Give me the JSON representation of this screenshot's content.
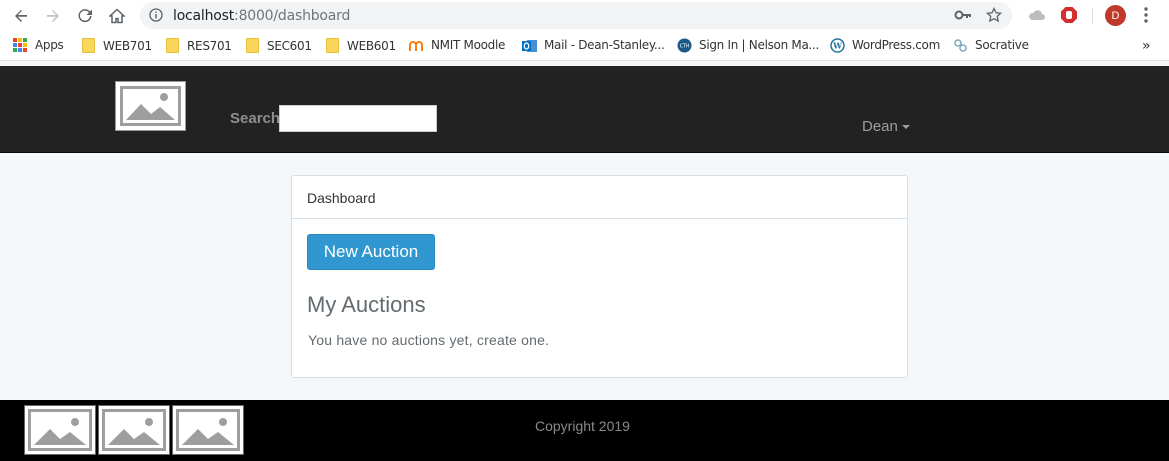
{
  "browser": {
    "url_host": "localhost",
    "url_rest": ":8000/dashboard",
    "profile_initial": "D"
  },
  "bookmarks": [
    {
      "label": "Apps",
      "icon": "apps-grid-icon"
    },
    {
      "label": "WEB701",
      "icon": "folder-icon"
    },
    {
      "label": "RES701",
      "icon": "folder-icon"
    },
    {
      "label": "SEC601",
      "icon": "folder-icon"
    },
    {
      "label": "WEB601",
      "icon": "folder-icon"
    },
    {
      "label": "NMIT Moodle",
      "icon": "moodle-icon"
    },
    {
      "label": "Mail - Dean-Stanley...",
      "icon": "outlook-icon"
    },
    {
      "label": "Sign In | Nelson Ma...",
      "icon": "site-icon"
    },
    {
      "label": "WordPress.com",
      "icon": "wordpress-icon"
    },
    {
      "label": "Socrative",
      "icon": "socrative-icon"
    }
  ],
  "navbar": {
    "search_label": "Search",
    "user_name": "Dean"
  },
  "panel": {
    "heading": "Dashboard",
    "new_auction_label": "New Auction",
    "section_title": "My Auctions",
    "empty_text": "You have no auctions yet, create one."
  },
  "footer": {
    "copyright": "Copyright 2019"
  },
  "colors": {
    "navbar_bg": "#222222",
    "primary_button": "#3097d1",
    "page_bg": "#f4f7fa",
    "footer_bg": "#000000"
  }
}
